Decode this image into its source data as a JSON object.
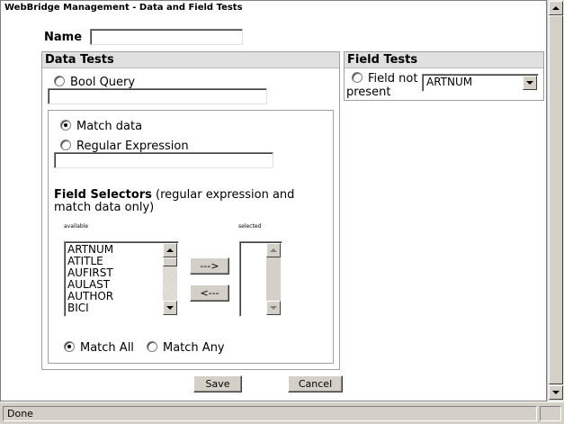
{
  "window": {
    "title": "WebBridge Management - Data and Field Tests",
    "status": "Done"
  },
  "form": {
    "name_label": "Name",
    "name_value": ""
  },
  "data_tests": {
    "heading": "Data Tests",
    "bool_query_label": "Bool Query",
    "bool_query_value": "",
    "match_data_label": "Match data",
    "regex_label": "Regular Expression",
    "regex_value": "",
    "field_selectors_title": "Field Selectors",
    "field_selectors_note": " (regular expression and match data only)",
    "available_label": "available",
    "selected_label": "selected",
    "available_items": [
      "ARTNUM",
      "ATITLE",
      "AUFIRST",
      "AULAST",
      "AUTHOR",
      "BICI"
    ],
    "add_button": "--->",
    "remove_button": "<---",
    "match_all_label": "Match All",
    "match_any_label": "Match Any"
  },
  "field_tests": {
    "heading": "Field Tests",
    "field_not_present_label_1": "Field not",
    "field_not_present_label_2": "present",
    "selected_field": "ARTNUM"
  },
  "buttons": {
    "save": "Save",
    "cancel": "Cancel"
  },
  "icons": {
    "scroll_up": "chevron-up-icon",
    "scroll_down": "chevron-down-icon",
    "dropdown": "dropdown-arrow-icon"
  }
}
